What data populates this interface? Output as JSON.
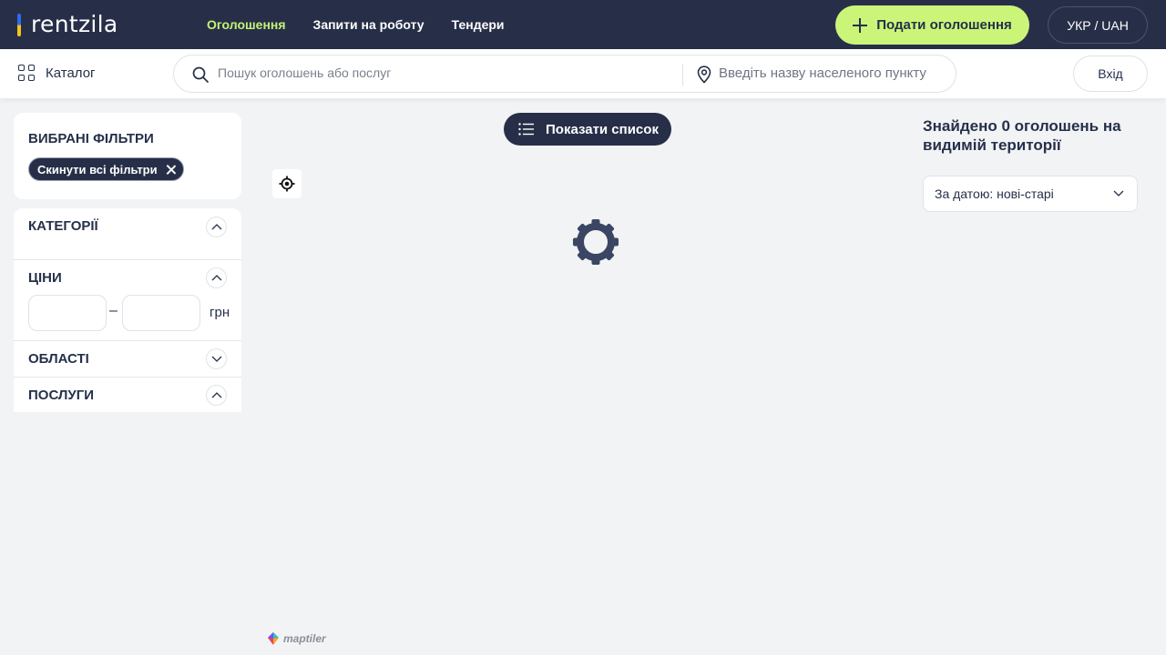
{
  "header": {
    "logo_text": "rentzila",
    "nav": [
      {
        "label": "Оголошення",
        "active": true
      },
      {
        "label": "Запити на роботу",
        "active": false
      },
      {
        "label": "Тендери",
        "active": false
      }
    ],
    "post_button": "Подати оголошення",
    "lang": "УКР / UAH"
  },
  "subbar": {
    "catalog_label": "Каталог",
    "search_placeholder": "Пошук оголошень або послуг",
    "location_placeholder": "Введіть назву населеного пункту",
    "login_label": "Вхід"
  },
  "filters": {
    "selected_title": "ВИБРАНІ ФІЛЬТРИ",
    "reset_chip": "Скинути всі фільтри",
    "sections": {
      "categories": "КАТЕГОРІЇ",
      "prices": "ЦІНИ",
      "regions": "ОБЛАСТІ",
      "services": "ПОСЛУГИ"
    },
    "currency": "грн",
    "price_dash": "–"
  },
  "map": {
    "show_list_button": "Показати список",
    "attribution": "maptiler"
  },
  "results": {
    "found_text": "Знайдено 0 оголошень на видимій території",
    "sort_value": "За датою: нові-старі"
  },
  "colors": {
    "header_bg": "#272f48",
    "accent": "#cbf578",
    "active_nav": "#c5f275"
  }
}
